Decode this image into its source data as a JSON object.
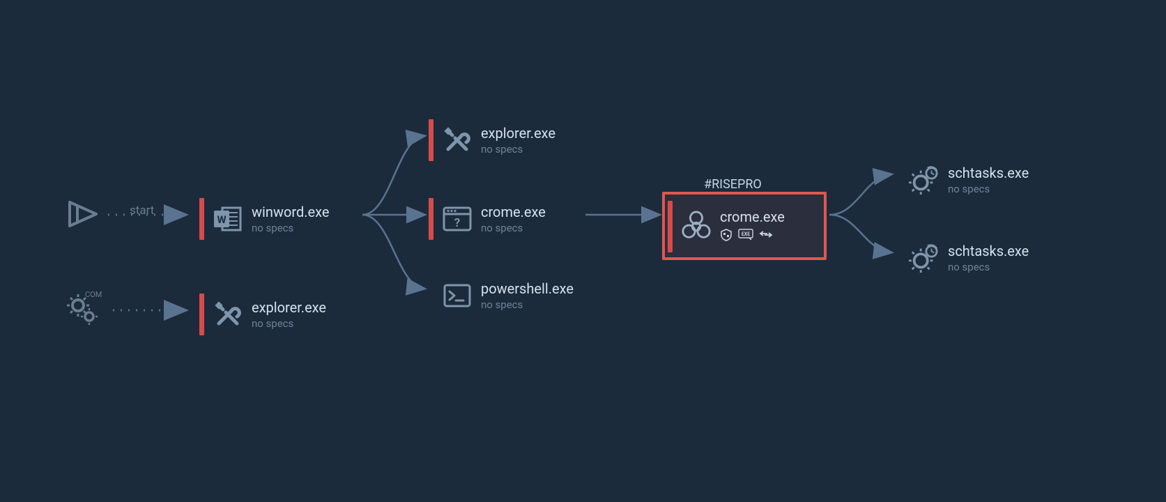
{
  "labels": {
    "start": "start",
    "com": "COM",
    "no_specs": "no specs"
  },
  "tag": "#RISEPRO",
  "roots": {
    "play": {
      "icon": "play"
    },
    "com": {
      "icon": "com-gears"
    }
  },
  "nodes": {
    "winword": {
      "name": "winword.exe",
      "sub": "no specs",
      "icon": "word",
      "redbar": true
    },
    "explorer1": {
      "name": "explorer.exe",
      "sub": "no specs",
      "icon": "tools",
      "redbar": true
    },
    "explorer2": {
      "name": "explorer.exe",
      "sub": "no specs",
      "icon": "tools",
      "redbar": true
    },
    "crome1": {
      "name": "crome.exe",
      "sub": "no specs",
      "icon": "window-question",
      "redbar": true
    },
    "powershell": {
      "name": "powershell.exe",
      "sub": "no specs",
      "icon": "terminal",
      "redbar": false
    },
    "crome2": {
      "name": "crome.exe",
      "sub": null,
      "icon": "biohazard",
      "redbar": true,
      "badges": [
        "shield-checker",
        "exe-badge",
        "swap-arrows"
      ]
    },
    "schtasks1": {
      "name": "schtasks.exe",
      "sub": "no specs",
      "icon": "gear-clock",
      "redbar": false
    },
    "schtasks2": {
      "name": "schtasks.exe",
      "sub": "no specs",
      "icon": "gear-clock",
      "redbar": false
    }
  },
  "colors": {
    "bg": "#1b2b3c",
    "text": "#d6e1ec",
    "muted": "#6f8298",
    "icon": "#7f95ab",
    "redbar": "#d84a4a",
    "highlight": "#e1574d",
    "arrow": "#5a7390"
  }
}
